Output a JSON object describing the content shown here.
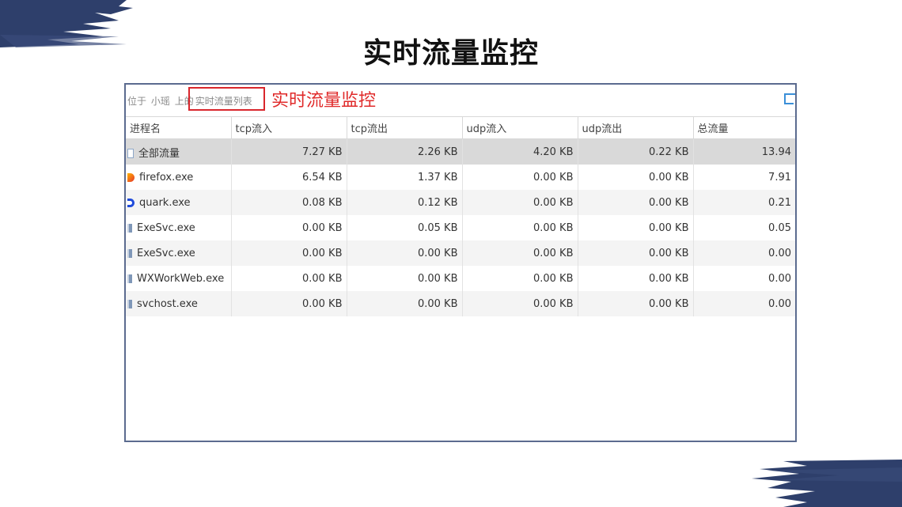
{
  "slide": {
    "title": "实时流量监控"
  },
  "panel": {
    "breadcrumb": [
      "位于",
      "小瑶",
      "上的"
    ],
    "breadcrumb_current": "实时流量列表",
    "annotation": "实时流量监控"
  },
  "table": {
    "columns": [
      "进程名",
      "tcp流入",
      "tcp流出",
      "udp流入",
      "udp流出",
      "总流量"
    ],
    "rows": [
      {
        "name": "全部流量",
        "icon": "document-icon",
        "tcp_in": "7.27 KB",
        "tcp_out": "2.26 KB",
        "udp_in": "4.20 KB",
        "udp_out": "0.22 KB",
        "total": "13.94"
      },
      {
        "name": "firefox.exe",
        "icon": "firefox-icon",
        "tcp_in": "6.54 KB",
        "tcp_out": "1.37 KB",
        "udp_in": "0.00 KB",
        "udp_out": "0.00 KB",
        "total": "7.91"
      },
      {
        "name": "quark.exe",
        "icon": "quark-icon",
        "tcp_in": "0.08 KB",
        "tcp_out": "0.12 KB",
        "udp_in": "0.00 KB",
        "udp_out": "0.00 KB",
        "total": "0.21"
      },
      {
        "name": "ExeSvc.exe",
        "icon": "app-icon",
        "tcp_in": "0.00 KB",
        "tcp_out": "0.05 KB",
        "udp_in": "0.00 KB",
        "udp_out": "0.00 KB",
        "total": "0.05"
      },
      {
        "name": "ExeSvc.exe",
        "icon": "app-icon",
        "tcp_in": "0.00 KB",
        "tcp_out": "0.00 KB",
        "udp_in": "0.00 KB",
        "udp_out": "0.00 KB",
        "total": "0.00"
      },
      {
        "name": "WXWorkWeb.exe",
        "icon": "app-icon",
        "tcp_in": "0.00 KB",
        "tcp_out": "0.00 KB",
        "udp_in": "0.00 KB",
        "udp_out": "0.00 KB",
        "total": "0.00"
      },
      {
        "name": "svchost.exe",
        "icon": "app-icon",
        "tcp_in": "0.00 KB",
        "tcp_out": "0.00 KB",
        "udp_in": "0.00 KB",
        "udp_out": "0.00 KB",
        "total": "0.00"
      }
    ]
  },
  "colors": {
    "frame": "#5b6b8f",
    "highlight": "#d9262c",
    "annotation": "#e02b2b",
    "brush": "#2e3f6b"
  }
}
